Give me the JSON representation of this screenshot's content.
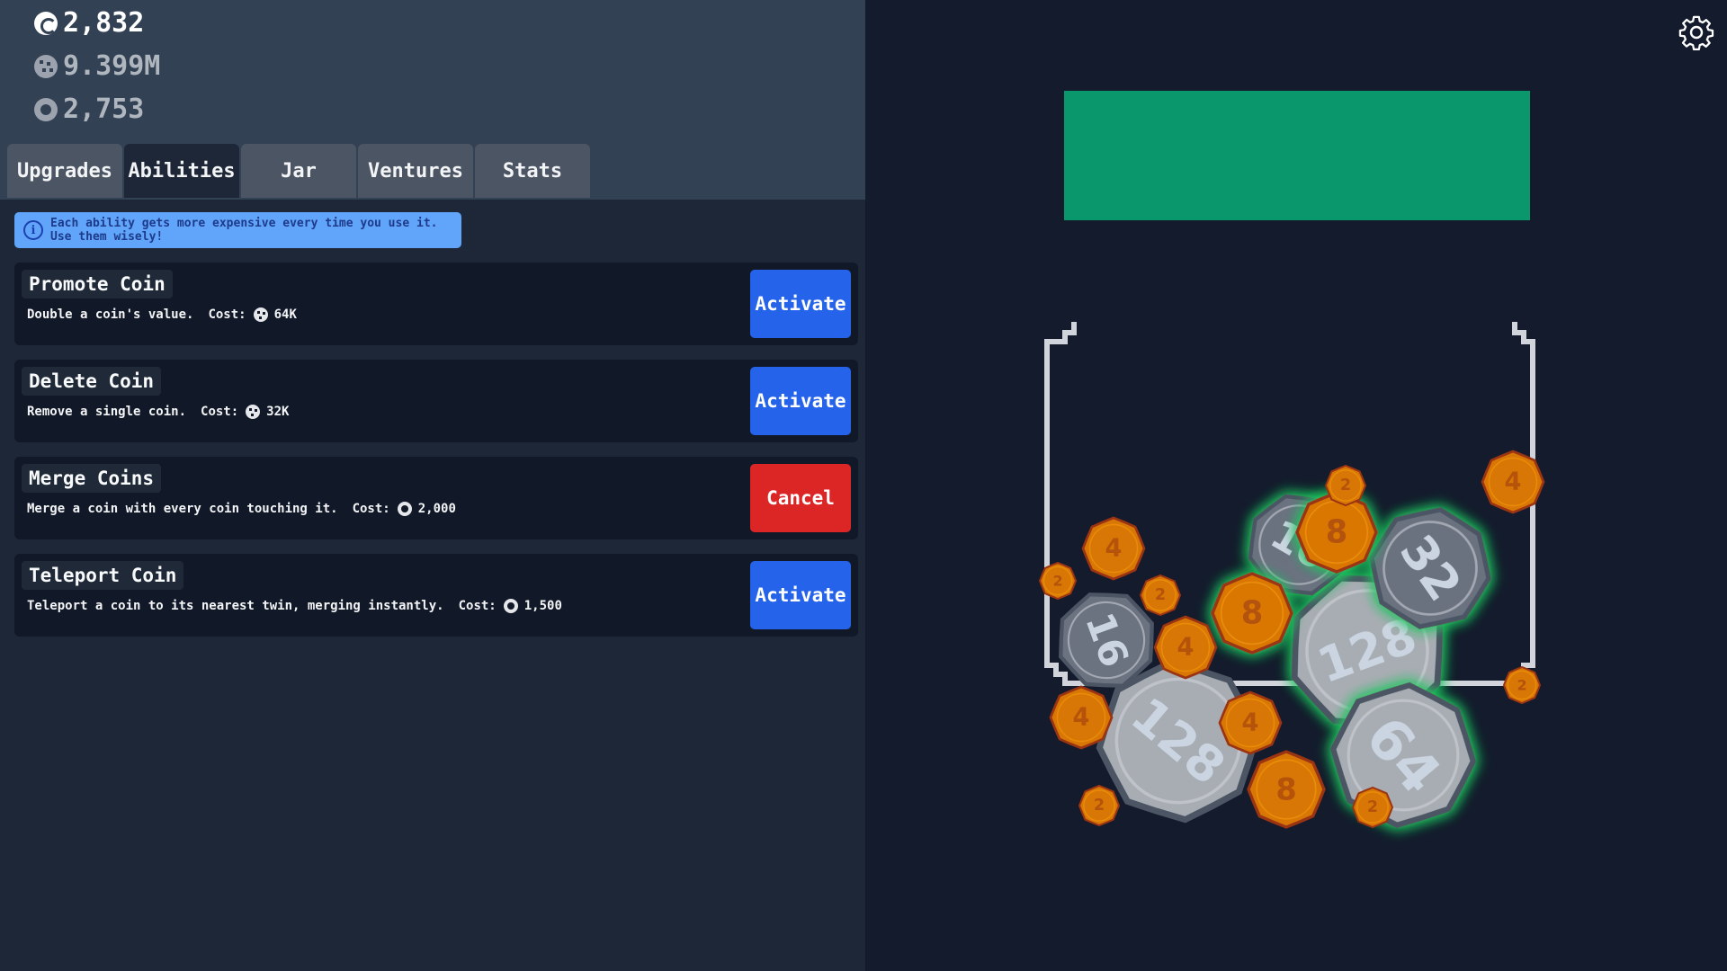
{
  "currencies": {
    "coins": "2,832",
    "cookies": "9.399M",
    "gears": "2,753"
  },
  "tabs": [
    {
      "label": "Upgrades",
      "active": false
    },
    {
      "label": "Abilities",
      "active": true
    },
    {
      "label": "Jar",
      "active": false
    },
    {
      "label": "Ventures",
      "active": false
    },
    {
      "label": "Stats",
      "active": false
    }
  ],
  "notice": "Each ability gets more expensive every time you use it. Use them wisely!",
  "cost_label": "Cost:",
  "abilities": [
    {
      "name": "Promote Coin",
      "desc": "Double a coin's value.",
      "cost_icon": "cookie-icon",
      "cost": "64K",
      "button": "Activate",
      "button_color": "#2563eb"
    },
    {
      "name": "Delete Coin",
      "desc": "Remove a single coin.",
      "cost_icon": "cookie-icon",
      "cost": "32K",
      "button": "Activate",
      "button_color": "#2563eb"
    },
    {
      "name": "Merge Coins",
      "desc": "Merge a coin with every coin touching it.",
      "cost_icon": "gear-icon",
      "cost": "2,000",
      "button": "Cancel",
      "button_color": "#dc2626"
    },
    {
      "name": "Teleport Coin",
      "desc": "Teleport a coin to its nearest twin, merging instantly.",
      "cost_icon": "gear-icon",
      "cost": "1,500",
      "button": "Activate",
      "button_color": "#2563eb"
    }
  ],
  "progress": {
    "fraction": 1.0,
    "color": "#0b976c"
  },
  "jar_coins": [
    {
      "value": "128",
      "kind": "silver",
      "glow": true
    },
    {
      "value": "128",
      "kind": "silver",
      "glow": false
    },
    {
      "value": "64",
      "kind": "silver",
      "glow": true
    },
    {
      "value": "32",
      "kind": "silver",
      "glow": true
    },
    {
      "value": "16",
      "kind": "silver",
      "glow": true
    },
    {
      "value": "16",
      "kind": "silver",
      "glow": false
    },
    {
      "value": "8",
      "kind": "bronze",
      "glow": true
    },
    {
      "value": "8",
      "kind": "bronze",
      "glow": true
    },
    {
      "value": "8",
      "kind": "bronze",
      "glow": false
    },
    {
      "value": "4",
      "kind": "bronze",
      "glow": false
    },
    {
      "value": "4",
      "kind": "bronze",
      "glow": false
    },
    {
      "value": "4",
      "kind": "bronze",
      "glow": false
    },
    {
      "value": "4",
      "kind": "bronze",
      "glow": false
    },
    {
      "value": "4",
      "kind": "bronze",
      "glow": false
    },
    {
      "value": "2",
      "kind": "bronze",
      "glow": false
    },
    {
      "value": "2",
      "kind": "bronze",
      "glow": false
    },
    {
      "value": "2",
      "kind": "bronze",
      "glow": false
    },
    {
      "value": "2",
      "kind": "bronze",
      "glow": false
    },
    {
      "value": "2",
      "kind": "bronze",
      "glow": false
    },
    {
      "value": "2",
      "kind": "bronze",
      "glow": false
    }
  ]
}
